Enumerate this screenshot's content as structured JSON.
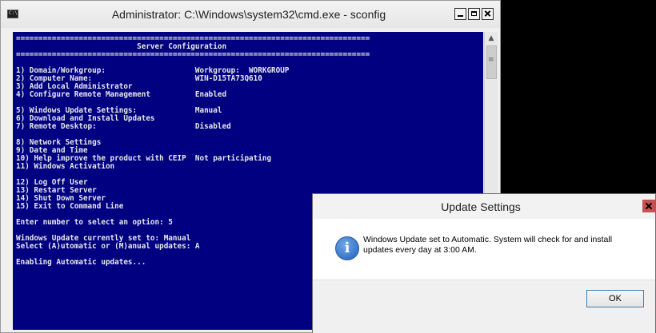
{
  "cmd_window": {
    "title": "Administrator: C:\\Windows\\system32\\cmd.exe - sconfig",
    "icon_label": "C:\\",
    "console_text": "===============================================================================\n                           Server Configuration\n===============================================================================\n\n1) Domain/Workgroup:                    Workgroup:  WORKGROUP\n2) Computer Name:                       WIN-D15TA73Q610\n3) Add Local Administrator\n4) Configure Remote Management          Enabled\n\n5) Windows Update Settings:             Manual\n6) Download and Install Updates\n7) Remote Desktop:                      Disabled\n\n8) Network Settings\n9) Date and Time\n10) Help improve the product with CEIP  Not participating\n11) Windows Activation\n\n12) Log Off User\n13) Restart Server\n14) Shut Down Server\n15) Exit to Command Line\n\nEnter number to select an option: 5\n\nWindows Update currently set to: Manual\nSelect (A)utomatic or (M)anual updates: A\n\nEnabling Automatic updates...",
    "colors": {
      "console_bg": "#000080",
      "console_fg": "#e8e8e8"
    }
  },
  "dialog": {
    "title": "Update Settings",
    "message": "Windows Update set to Automatic.  System will check for and install updates every day at 3:00 AM.",
    "ok_label": "OK",
    "icon_glyph": "i",
    "colors": {
      "close_button": "#c75050"
    }
  }
}
